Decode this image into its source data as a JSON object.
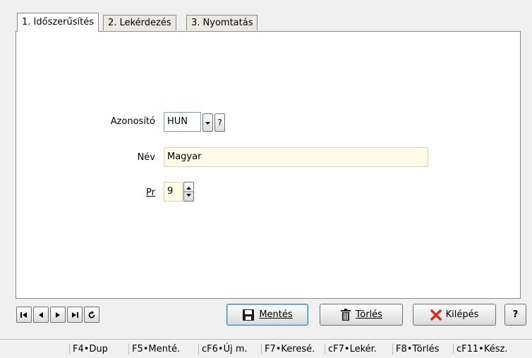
{
  "tabs": [
    {
      "label": "1. Időszerűsítés",
      "active": true
    },
    {
      "label": "2. Lekérdezés",
      "active": false
    },
    {
      "label": "3. Nyomtatás",
      "active": false
    }
  ],
  "form": {
    "azonosito_label": "Azonosító",
    "azonosito_value": "HUN",
    "help_label": "?",
    "nev_label": "Név",
    "nev_value": "Magyar",
    "pr_label": "Pr",
    "pr_value": "9"
  },
  "buttons": {
    "mentes": "Mentés",
    "torles": "Törlés",
    "kilepes": "Kilépés",
    "help": "?"
  },
  "statusbar": [
    "F4•Dup",
    "F5•Menté.",
    "cF6•Új m.",
    "F7•Keresé.",
    "cF7•Lekér.",
    "F8•Törlés",
    "cF11•Kész."
  ],
  "colors": {
    "input_bg": "#fffbe6",
    "tab_active_bg": "#ffffff",
    "cancel_x": "#d32f1f"
  }
}
